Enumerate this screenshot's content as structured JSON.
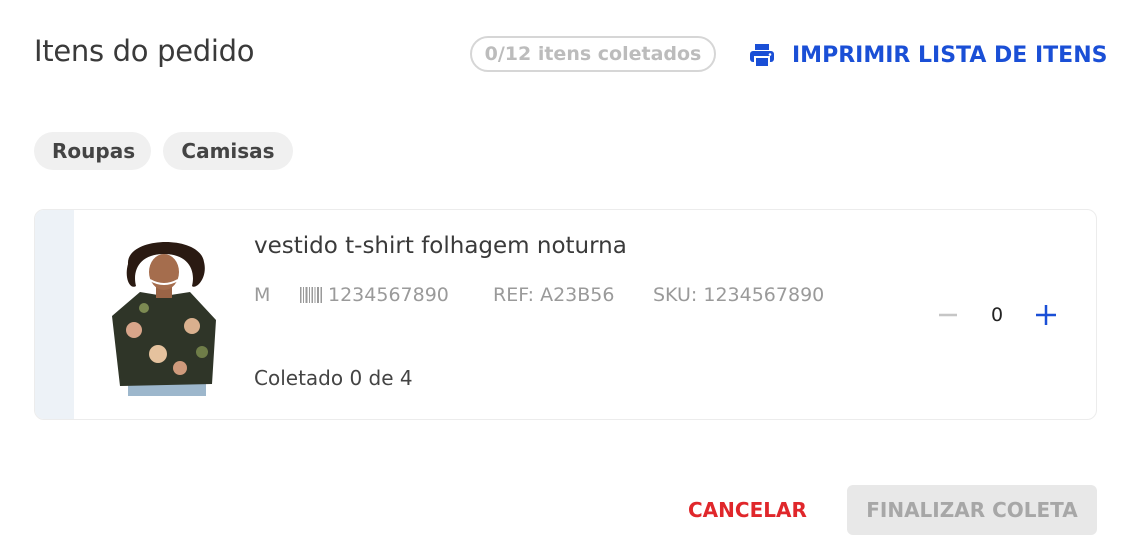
{
  "header": {
    "title": "Itens do pedido",
    "collected_badge": "0/12 itens coletados",
    "print_label": "IMPRIMIR LISTA DE ITENS",
    "print_icon": "printer-icon"
  },
  "categories": [
    "Roupas",
    "Camisas"
  ],
  "item": {
    "name": "vestido t-shirt folhagem noturna",
    "size": "M",
    "ean": "1234567890",
    "ref": "REF: A23B56",
    "sku": "SKU: 1234567890",
    "collected": "Coletado 0 de 4",
    "quantity": "0",
    "image_icon": "product-photo"
  },
  "footer": {
    "cancel_label": "CANCELAR",
    "finalize_label": "FINALIZAR COLETA"
  },
  "colors": {
    "accent": "#1a4fd6",
    "danger": "#e0272b",
    "disabled_bg": "#e8e8e8",
    "rail": "#edf2f7"
  }
}
